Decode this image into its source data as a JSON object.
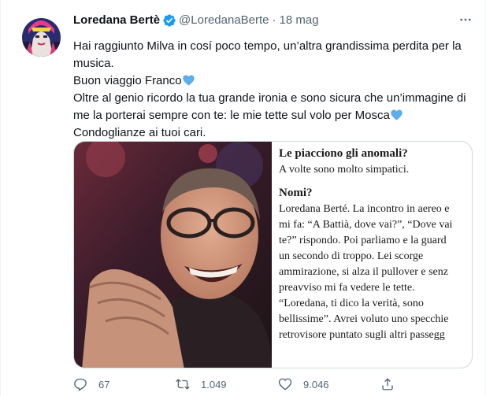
{
  "tweet": {
    "author_name": "Loredana Bertè",
    "handle": "@LoredanaBerte",
    "separator": "·",
    "date": "18 mag",
    "lines": [
      "Hai raggiunto Milva in cosí poco tempo, un’altra grandissima perdita per la",
      "musica.",
      "Buon viaggio Franco",
      "Oltre al  genio ricordo la tua grande ironia e sono sicura che un’immagine di",
      "me la porterai sempre con te: le mie tette sul volo per Mosca",
      "Condoglianze ai tuoi cari."
    ]
  },
  "media": {
    "article": {
      "q1": "Le piacciono gli anomali?",
      "a1": "A volte sono molto simpatici.",
      "q2": "Nomi?",
      "a2_lines": [
        "Loredana Berté. La incontro in aereo e",
        "mi fa: “A Battià, dove vai?”, “Dove vai",
        "te?” rispondo. Poi parliamo e la guard",
        "un secondo di troppo. Lei scorge",
        "ammirazione, si alza il pullover e senz",
        "preavviso mi fa vedere le tette.",
        "“Loredana, ti dico la verità, sono",
        "bellissime”. Avrei voluto uno specchie",
        "retrovisore puntato sugli altri passegg"
      ]
    }
  },
  "actions": {
    "replies": "67",
    "retweets": "1.049",
    "likes": "9.046"
  },
  "icons": {
    "verified": "verified-badge-icon",
    "more": "more-options-icon",
    "heart_emoji": "blue-heart-icon",
    "reply": "reply-icon",
    "retweet": "retweet-icon",
    "like": "like-icon",
    "share": "share-icon"
  },
  "colors": {
    "verified": "#1d9bf0",
    "heart_emoji": "#5dadec",
    "secondary_text": "#536471"
  }
}
